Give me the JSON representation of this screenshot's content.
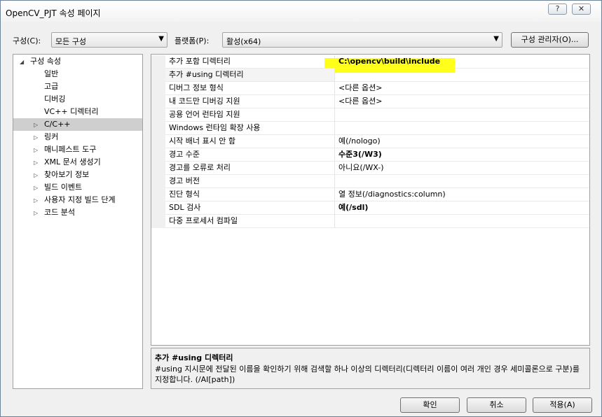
{
  "window": {
    "title": "OpenCV_PJT 속성 페이지",
    "help_glyph": "?",
    "close_glyph": "✕"
  },
  "toolbar": {
    "config_label": "구성(C):",
    "config_value": "모든 구성",
    "platform_label": "플랫폼(P):",
    "platform_value": "활성(x64)",
    "config_manager_label": "구성 관리자(O)..."
  },
  "tree": {
    "items": [
      {
        "label": "구성 속성",
        "expander": "◢"
      },
      {
        "label": "일반"
      },
      {
        "label": "고급"
      },
      {
        "label": "디버깅"
      },
      {
        "label": "VC++ 디렉터리"
      },
      {
        "label": "C/C++",
        "expander": "▷"
      },
      {
        "label": "링커",
        "expander": "▷"
      },
      {
        "label": "매니페스트 도구",
        "expander": "▷"
      },
      {
        "label": "XML 문서 생성기",
        "expander": "▷"
      },
      {
        "label": "찾아보기 정보",
        "expander": "▷"
      },
      {
        "label": "빌드 이벤트",
        "expander": "▷"
      },
      {
        "label": "사용자 지정 빌드 단계",
        "expander": "▷"
      },
      {
        "label": "코드 분석",
        "expander": "▷"
      }
    ]
  },
  "properties": [
    {
      "name": "추가 포함 디렉터리",
      "value": "C:\\opencv\\build\\include"
    },
    {
      "name": "추가 #using 디렉터리",
      "value": ""
    },
    {
      "name": "디버그 정보 형식",
      "value": "<다른 옵션>"
    },
    {
      "name": "내 코드만 디버깅 지원",
      "value": "<다른 옵션>"
    },
    {
      "name": "공용 언어 런타임 지원",
      "value": ""
    },
    {
      "name": "Windows 런타임 확장 사용",
      "value": ""
    },
    {
      "name": "시작 배너 표시 안 함",
      "value": "예(/nologo)"
    },
    {
      "name": "경고 수준",
      "value": "수준3(/W3)"
    },
    {
      "name": "경고를 오류로 처리",
      "value": "아니요(/WX-)"
    },
    {
      "name": "경고 버전",
      "value": ""
    },
    {
      "name": "진단 형식",
      "value": "열 정보(/diagnostics:column)"
    },
    {
      "name": "SDL 검사",
      "value": "예(/sdl)"
    },
    {
      "name": "다중 프로세서 컴파일",
      "value": ""
    }
  ],
  "description": {
    "title": "추가 #using 디렉터리",
    "text": "#using 지시문에 전달된 이름을 확인하기 위해 검색할 하나 이상의 디렉터리(디렉터리 이름이 여러 개인 경우 세미콜론으로 구분)를 지정합니다.  (/AI[path])"
  },
  "buttons": {
    "ok": "확인",
    "cancel": "취소",
    "apply": "적용(A)"
  },
  "colors": {
    "highlight": "#ffff1a",
    "selection": "#cfcfcf"
  }
}
